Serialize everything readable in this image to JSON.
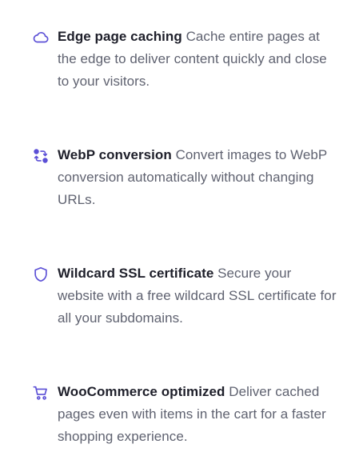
{
  "features": [
    {
      "icon": "cloud-icon",
      "title": "Edge page caching",
      "description": "Cache entire pages at the edge to deliver content quickly and close to your visitors."
    },
    {
      "icon": "image-convert-icon",
      "title": "WebP conversion",
      "description": "Convert images to WebP conversion automatically without changing URLs."
    },
    {
      "icon": "shield-icon",
      "title": "Wildcard SSL certificate",
      "description": "Secure your website with a free wildcard SSL certificate for all your subdomains."
    },
    {
      "icon": "shopping-cart-icon",
      "title": "WooCommerce optimized",
      "description": "Deliver cached pages even with items in the cart for a faster shopping experience."
    }
  ],
  "colors": {
    "icon": "#5b4fd6",
    "title": "#1e1f2a",
    "body": "#5f6270",
    "background": "#ffffff"
  }
}
